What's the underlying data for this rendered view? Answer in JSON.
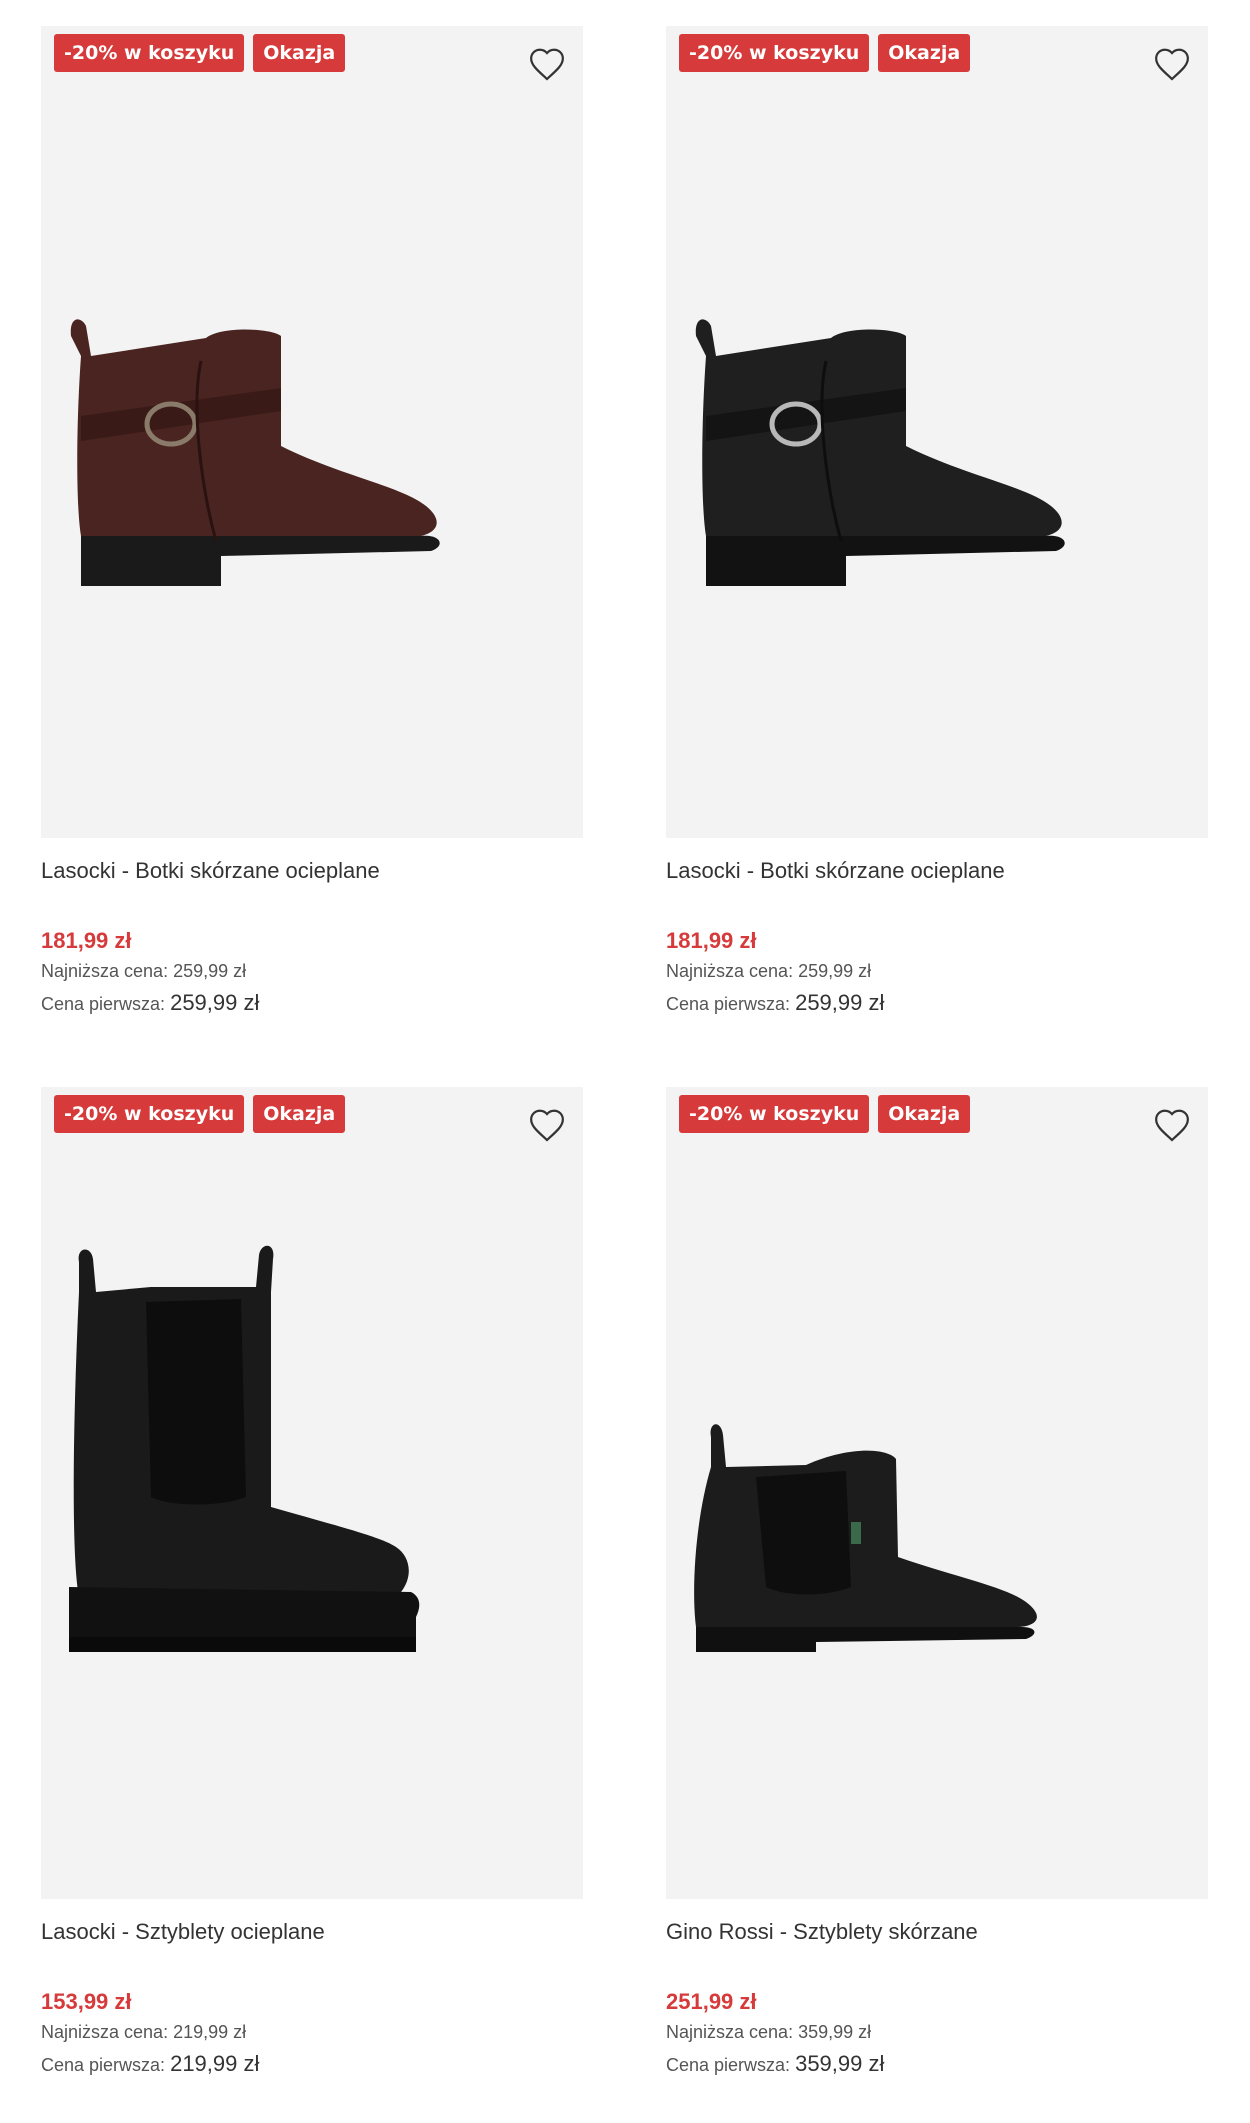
{
  "products": [
    {
      "badges": [
        "-20% w koszyku",
        "Okazja"
      ],
      "title": "Lasocki - Botki skórzane ocieplane",
      "price": "181,99 zł",
      "lowest_label": "Najniższa cena:",
      "lowest_value": "259,99 zł",
      "first_label": "Cena pierwsza:",
      "first_value": "259,99 zł",
      "shoe_color": "#4a2420"
    },
    {
      "badges": [
        "-20% w koszyku",
        "Okazja"
      ],
      "title": "Lasocki - Botki skórzane ocieplane",
      "price": "181,99 zł",
      "lowest_label": "Najniższa cena:",
      "lowest_value": "259,99 zł",
      "first_label": "Cena pierwsza:",
      "first_value": "259,99 zł",
      "shoe_color": "#1f1f1f"
    },
    {
      "badges": [
        "-20% w koszyku",
        "Okazja"
      ],
      "title": "Lasocki - Sztyblety ocieplane",
      "price": "153,99 zł",
      "lowest_label": "Najniższa cena:",
      "lowest_value": "219,99 zł",
      "first_label": "Cena pierwsza:",
      "first_value": "219,99 zł",
      "shoe_color": "#1a1a1a"
    },
    {
      "badges": [
        "-20% w koszyku",
        "Okazja"
      ],
      "title": "Gino Rossi - Sztyblety skórzane",
      "price": "251,99 zł",
      "lowest_label": "Najniższa cena:",
      "lowest_value": "359,99 zł",
      "first_label": "Cena pierwsza:",
      "first_value": "359,99 zł",
      "shoe_color": "#1c1c1c"
    }
  ],
  "icons": {
    "favorite": "heart-outline-icon"
  },
  "colors": {
    "accent": "#d63a3a",
    "image_bg": "#f3f3f3"
  }
}
